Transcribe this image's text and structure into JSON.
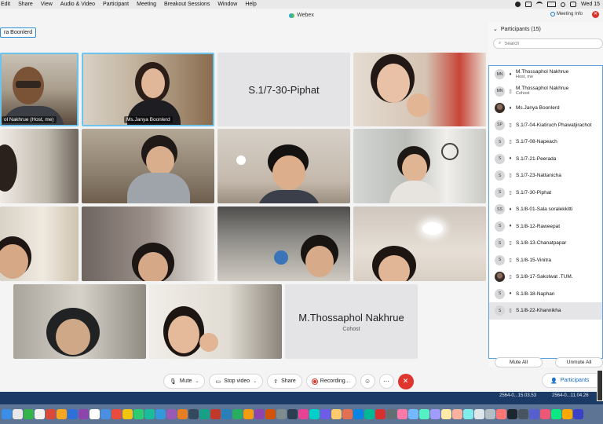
{
  "menubar": {
    "items": [
      "Edit",
      "Share",
      "View",
      "Audio & Video",
      "Participant",
      "Meeting",
      "Breakout Sessions",
      "Window",
      "Help"
    ],
    "clock": "Wed 15"
  },
  "window": {
    "title": "Webex",
    "meeting_info": "Meeting Info"
  },
  "active_speaker": "ra Boonlerd",
  "tiles": {
    "t1_label": "ol Nakhrue  (Host, me)",
    "t2_label": "Ms.Janya Boonlerd",
    "t3_name": "S.1/7-30-Piphat",
    "t15_name": "M.Thossaphol Nakhrue",
    "t15_role": "Cohost"
  },
  "controls": {
    "mute": "Mute",
    "stop_video": "Stop video",
    "share": "Share",
    "recording": "Recording...",
    "participants": "Participants"
  },
  "panel": {
    "title": "Participants (15)",
    "search_placeholder": "Search",
    "mute_all": "Mute All",
    "unmute_all": "Unmute All",
    "participants": [
      {
        "initials": "MN",
        "name": "M.Thossaphol Nakhrue",
        "role": "Host, me",
        "device": "♦"
      },
      {
        "initials": "MN",
        "name": "M.Thossaphol Nakhrue",
        "role": "Cohost",
        "device": "▯"
      },
      {
        "initials": "",
        "name": "Ms.Janya Boonlerd",
        "role": "",
        "device": "♦"
      },
      {
        "initials": "SP",
        "name": "S.1/7-04-Kiatiruch Phawatjirachot",
        "role": "",
        "device": "▯"
      },
      {
        "initials": "S",
        "name": "S.1/7-08-Napeach",
        "role": "",
        "device": "▯"
      },
      {
        "initials": "S",
        "name": "S.1/7-21-Peerada",
        "role": "",
        "device": "♦"
      },
      {
        "initials": "S",
        "name": "S.1/7-23-Nattanicha",
        "role": "",
        "device": "▯"
      },
      {
        "initials": "S",
        "name": "S.1/7-30-Piphat",
        "role": "",
        "device": "▯"
      },
      {
        "initials": "SS",
        "name": "S.1/8-01-Sala soralekkitti",
        "role": "",
        "device": "♦"
      },
      {
        "initials": "S",
        "name": "S.1/8-12-Raweepat",
        "role": "",
        "device": "♦"
      },
      {
        "initials": "S",
        "name": "S.1/8-13-Chanatpapar",
        "role": "",
        "device": "▯"
      },
      {
        "initials": "S",
        "name": "S.1/8-15-Vinitra",
        "role": "",
        "device": "▯"
      },
      {
        "initials": "",
        "name": "S.1/8-17-Sakolwat .TUM.",
        "role": "",
        "device": "▯"
      },
      {
        "initials": "S",
        "name": "S.1/8-18-Naphan",
        "role": "",
        "device": "♦"
      },
      {
        "initials": "S",
        "name": "S.1/8-22-Khannikha",
        "role": "",
        "device": "▯"
      }
    ]
  },
  "desktop": {
    "file1": "2564-0...15.03.53",
    "file2": "2564-0...11.04.26"
  },
  "colors": {
    "accent": "#1478d4",
    "end_call": "#e0352c",
    "active_border": "#6cc4ee"
  }
}
